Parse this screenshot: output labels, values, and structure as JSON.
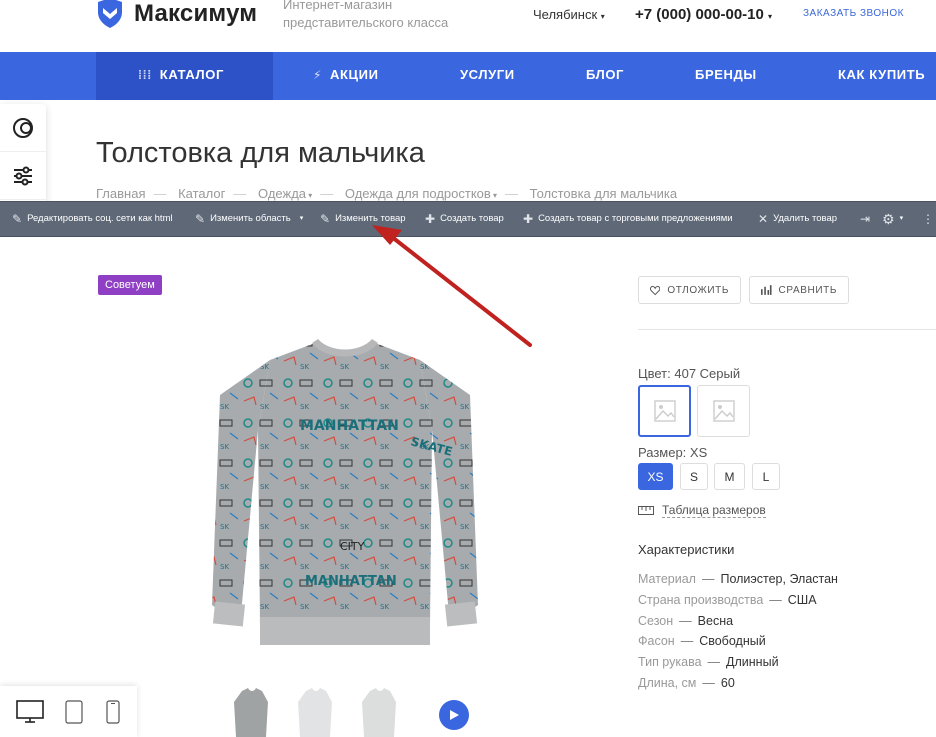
{
  "header": {
    "logo_text": "Максимум",
    "tagline": "Интернет-магазин представительского класса",
    "city": "Челябинск",
    "phone": "+7 (000) 000-00-10",
    "callback": "ЗАКАЗАТЬ ЗВОНОК"
  },
  "nav": {
    "items": [
      {
        "label": "КАТАЛОГ"
      },
      {
        "label": "АКЦИИ"
      },
      {
        "label": "УСЛУГИ"
      },
      {
        "label": "БЛОГ"
      },
      {
        "label": "БРЕНДЫ"
      },
      {
        "label": "КАК КУПИТЬ"
      }
    ]
  },
  "page": {
    "title": "Толстовка для мальчика",
    "breadcrumb": [
      "Главная",
      "Каталог",
      "Одежда",
      "Одежда для подростков",
      "Толстовка для мальчика"
    ]
  },
  "admin_bar": {
    "items": [
      {
        "label": "Редактировать соц. сети как html"
      },
      {
        "label": "Изменить область"
      },
      {
        "label": "Изменить товар"
      },
      {
        "label": "Создать товар"
      },
      {
        "label": "Создать товар с торговыми предложениями"
      },
      {
        "label": "Удалить товар"
      }
    ]
  },
  "product": {
    "badge": "Советуем",
    "defer_label": "ОТЛОЖИТЬ",
    "compare_label": "СРАВНИТЬ",
    "color_label": "Цвет: 407 Серый",
    "size_label": "Размер: XS",
    "sizes": [
      "XS",
      "S",
      "M",
      "L"
    ],
    "selected_size": "XS",
    "size_table_label": "Таблица размеров",
    "chars_title": "Характеристики",
    "characteristics": [
      {
        "key": "Материал",
        "value": "Полиэстер, Эластан"
      },
      {
        "key": "Страна производства",
        "value": "США"
      },
      {
        "key": "Сезон",
        "value": "Весна"
      },
      {
        "key": "Фасон",
        "value": "Свободный"
      },
      {
        "key": "Тип рукава",
        "value": "Длинный"
      },
      {
        "key": "Длина, см",
        "value": "60"
      }
    ]
  },
  "colors": {
    "accent": "#3a67e0",
    "badge": "#8e3fc4",
    "admin_bar": "#5e6877",
    "arrow": "#c0221f"
  }
}
